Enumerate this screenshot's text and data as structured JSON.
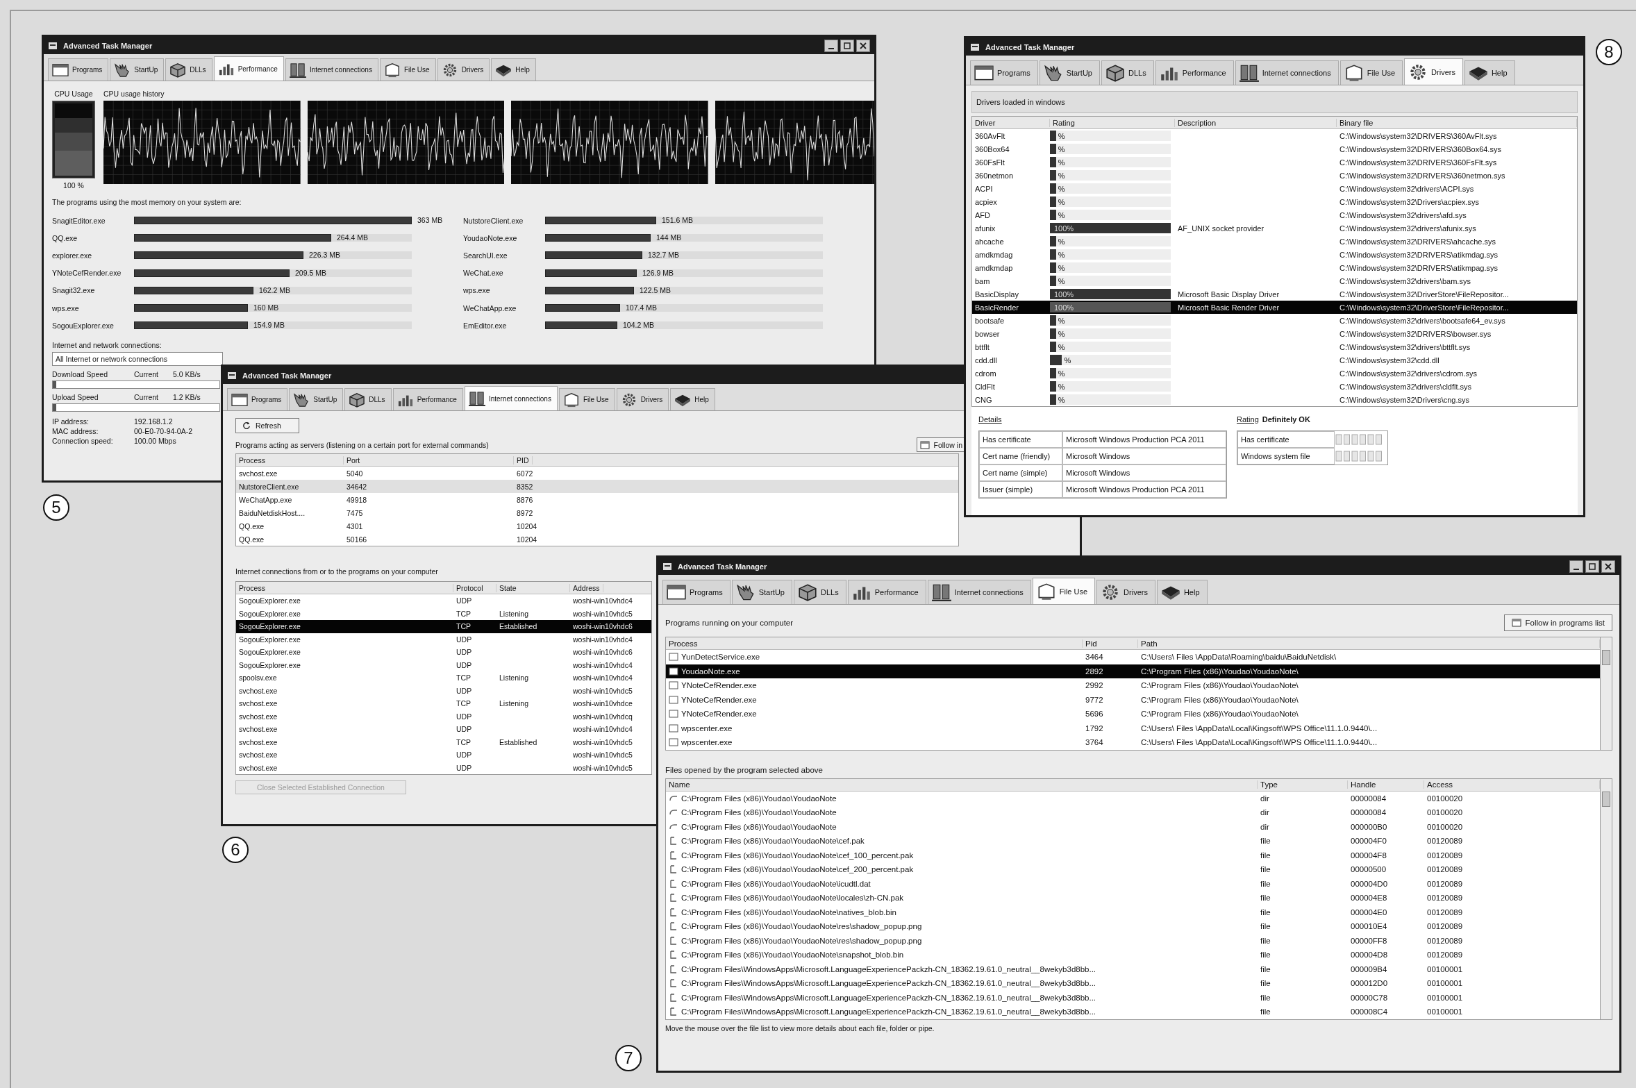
{
  "windows": [
    {
      "kind": "performance",
      "title": "Advanced Task Manager",
      "callout": "5",
      "window_buttons": true,
      "tabs": [
        {
          "label": "Programs",
          "selected": false
        },
        {
          "label": "StartUp",
          "selected": false
        },
        {
          "label": "DLLs",
          "selected": false
        },
        {
          "label": "Performance",
          "selected": true
        },
        {
          "label": "Internet connections",
          "selected": false
        },
        {
          "label": "File Use",
          "selected": false
        },
        {
          "label": "Drivers",
          "selected": false
        },
        {
          "label": "Help",
          "selected": false
        }
      ],
      "cpu": {
        "usage_label": "CPU Usage",
        "history_label": "CPU usage history",
        "reading": "100 %",
        "level": 1.0
      },
      "memory": {
        "caption": "The programs using the most memory on your system are:",
        "columns": [
          [
            {
              "name": "SnagitEditor.exe",
              "value": "363 MB",
              "level": 1.0
            },
            {
              "name": "QQ.exe",
              "value": "264.4 MB",
              "level": 0.71
            },
            {
              "name": "explorer.exe",
              "value": "226.3 MB",
              "level": 0.61
            },
            {
              "name": "YNoteCefRender.exe",
              "value": "209.5 MB",
              "level": 0.56
            },
            {
              "name": "Snagit32.exe",
              "value": "162.2 MB",
              "level": 0.43
            },
            {
              "name": "wps.exe",
              "value": "160 MB",
              "level": 0.41
            },
            {
              "name": "SogouExplorer.exe",
              "value": "154.9 MB",
              "level": 0.41
            }
          ],
          [
            {
              "name": "NutstoreClient.exe",
              "value": "151.6 MB",
              "level": 0.4
            },
            {
              "name": "YoudaoNote.exe",
              "value": "144 MB",
              "level": 0.38
            },
            {
              "name": "SearchUI.exe",
              "value": "132.7 MB",
              "level": 0.35
            },
            {
              "name": "WeChat.exe",
              "value": "126.9 MB",
              "level": 0.33
            },
            {
              "name": "wps.exe",
              "value": "122.5 MB",
              "level": 0.32
            },
            {
              "name": "WeChatApp.exe",
              "value": "107.4 MB",
              "level": 0.27
            },
            {
              "name": "EmEditor.exe",
              "value": "104.2 MB",
              "level": 0.26
            }
          ]
        ]
      },
      "network": {
        "caption": "Internet and network connections:",
        "dropdown": "All Internet or network connections",
        "speeds": [
          {
            "label": "Download Speed",
            "current_label": "Current",
            "reading": "5.0 KB/s",
            "level": 0.02
          },
          {
            "label": "Upload Speed",
            "current_label": "Current",
            "reading": "1.2 KB/s",
            "level": 0.02
          }
        ],
        "info": [
          {
            "label": "IP address:",
            "value": "192.168.1.2"
          },
          {
            "label": "MAC address:",
            "value": "00-E0-70-94-0A-2"
          },
          {
            "label": "Connection speed:",
            "value": "100.00 Mbps"
          }
        ]
      }
    },
    {
      "kind": "connections",
      "title": "Advanced Task Manager",
      "callout": "6",
      "window_buttons": false,
      "tabs": [
        {
          "label": "Programs",
          "selected": false
        },
        {
          "label": "StartUp",
          "selected": false
        },
        {
          "label": "DLLs",
          "selected": false
        },
        {
          "label": "Performance",
          "selected": false
        },
        {
          "label": "Internet connections",
          "selected": true
        },
        {
          "label": "File Use",
          "selected": false
        },
        {
          "label": "Drivers",
          "selected": false
        },
        {
          "label": "Help",
          "selected": false
        }
      ],
      "refresh_button": "Refresh",
      "follow_button": "Follow in",
      "servers": {
        "caption": "Programs acting as servers (listening on a certain port for external commands)",
        "columns": [
          "Process",
          "Port",
          "PID"
        ],
        "rows": [
          {
            "cells": [
              "svchost.exe",
              "5040",
              "6072"
            ],
            "selected": false
          },
          {
            "cells": [
              "NutstoreClient.exe",
              "34642",
              "8352"
            ],
            "selected": true
          },
          {
            "cells": [
              "WeChatApp.exe",
              "49918",
              "8876"
            ],
            "selected": false
          },
          {
            "cells": [
              "BaiduNetdiskHost....",
              "7475",
              "8972"
            ],
            "selected": false
          },
          {
            "cells": [
              "QQ.exe",
              "4301",
              "10204"
            ],
            "selected": false
          },
          {
            "cells": [
              "QQ.exe",
              "50166",
              "10204"
            ],
            "selected": false
          }
        ]
      },
      "connections": {
        "caption": "Internet connections from or to the programs on your computer",
        "columns": [
          "Process",
          "Protocol",
          "State",
          "Address"
        ],
        "rows": [
          {
            "process": "SogouExplorer.exe",
            "protocol": "UDP",
            "address": "woshi-win10vhdc4",
            "selected": false
          },
          {
            "process": "SogouExplorer.exe",
            "protocol": "TCP",
            "state": "Listening",
            "address": "woshi-win10vhdc5",
            "selected": false
          },
          {
            "process": "SogouExplorer.exe",
            "protocol": "TCP",
            "state": "Established",
            "address": "woshi-win10vhdc6",
            "selected": true
          },
          {
            "process": "SogouExplorer.exe",
            "protocol": "UDP",
            "address": "woshi-win10vhdc4",
            "selected": false
          },
          {
            "process": "SogouExplorer.exe",
            "protocol": "UDP",
            "address": "woshi-win10vhdc6",
            "selected": false
          },
          {
            "process": "SogouExplorer.exe",
            "protocol": "UDP",
            "address": "woshi-win10vhdc4",
            "selected": false
          },
          {
            "process": "spoolsv.exe",
            "protocol": "TCP",
            "state": "Listening",
            "address": "woshi-win10vhdc4",
            "selected": false
          },
          {
            "process": "svchost.exe",
            "protocol": "UDP",
            "address": "woshi-win10vhdc5",
            "selected": false
          },
          {
            "process": "svchost.exe",
            "protocol": "TCP",
            "state": "Listening",
            "address": "woshi-win10vhdce",
            "selected": false
          },
          {
            "process": "svchost.exe",
            "protocol": "UDP",
            "address": "woshi-win10vhdcq",
            "selected": false
          },
          {
            "process": "svchost.exe",
            "protocol": "UDP",
            "address": "woshi-win10vhdc4",
            "selected": false
          },
          {
            "process": "svchost.exe",
            "protocol": "TCP",
            "state": "Established",
            "address": "woshi-win10vhdc5",
            "selected": false
          },
          {
            "process": "svchost.exe",
            "protocol": "UDP",
            "address": "woshi-win10vhdc5",
            "selected": false
          },
          {
            "process": "svchost.exe",
            "protocol": "UDP",
            "address": "woshi-win10vhdc5",
            "selected": false
          }
        ]
      },
      "close_button": {
        "label": "Close Selected Established Connection",
        "disabled": true
      }
    },
    {
      "kind": "drivers",
      "title": "Advanced Task Manager",
      "callout": "8",
      "window_buttons": false,
      "tabs": [
        {
          "label": "Programs",
          "selected": false
        },
        {
          "label": "StartUp",
          "selected": false
        },
        {
          "label": "DLLs",
          "selected": false
        },
        {
          "label": "Performance",
          "selected": false
        },
        {
          "label": "Internet connections",
          "selected": false
        },
        {
          "label": "File Use",
          "selected": false
        },
        {
          "label": "Drivers",
          "selected": true
        },
        {
          "label": "Help",
          "selected": false
        }
      ],
      "caption": "Drivers loaded in windows",
      "columns": [
        "Driver",
        "Rating",
        "Description",
        "Binary file"
      ],
      "rows": [
        {
          "driver": "360AvFlt",
          "rating": {
            "reading": "%",
            "level": 0.05
          },
          "binary": "C:\\Windows\\system32\\DRIVERS\\360AvFlt.sys",
          "selected": false
        },
        {
          "driver": "360Box64",
          "rating": {
            "reading": "%",
            "level": 0.05
          },
          "binary": "C:\\Windows\\system32\\DRIVERS\\360Box64.sys",
          "selected": false
        },
        {
          "driver": "360FsFlt",
          "rating": {
            "reading": "%",
            "level": 0.05
          },
          "binary": "C:\\Windows\\system32\\DRIVERS\\360FsFlt.sys",
          "selected": false
        },
        {
          "driver": "360netmon",
          "rating": {
            "reading": "%",
            "level": 0.05
          },
          "binary": "C:\\Windows\\system32\\DRIVERS\\360netmon.sys",
          "selected": false
        },
        {
          "driver": "ACPI",
          "rating": {
            "reading": "%",
            "level": 0.05
          },
          "binary": "C:\\Windows\\system32\\drivers\\ACPI.sys",
          "selected": false
        },
        {
          "driver": "acpiex",
          "rating": {
            "reading": "%",
            "level": 0.05
          },
          "binary": "C:\\Windows\\system32\\Drivers\\acpiex.sys",
          "selected": false
        },
        {
          "driver": "AFD",
          "rating": {
            "reading": "%",
            "level": 0.05
          },
          "binary": "C:\\Windows\\system32\\drivers\\afd.sys",
          "selected": false
        },
        {
          "driver": "afunix",
          "rating": {
            "reading": "100%",
            "level": 1.0
          },
          "description": "AF_UNIX socket provider",
          "binary": "C:\\Windows\\system32\\drivers\\afunix.sys",
          "selected": false
        },
        {
          "driver": "ahcache",
          "rating": {
            "reading": "%",
            "level": 0.05
          },
          "binary": "C:\\Windows\\system32\\DRIVERS\\ahcache.sys",
          "selected": false
        },
        {
          "driver": "amdkmdag",
          "rating": {
            "reading": "%",
            "level": 0.05
          },
          "binary": "C:\\Windows\\system32\\DRIVERS\\atikmdag.sys",
          "selected": false
        },
        {
          "driver": "amdkmdap",
          "rating": {
            "reading": "%",
            "level": 0.05
          },
          "binary": "C:\\Windows\\system32\\DRIVERS\\atikmpag.sys",
          "selected": false
        },
        {
          "driver": "bam",
          "rating": {
            "reading": "%",
            "level": 0.05
          },
          "binary": "C:\\Windows\\system32\\drivers\\bam.sys",
          "selected": false
        },
        {
          "driver": "BasicDisplay",
          "rating": {
            "reading": "100%",
            "level": 1.0
          },
          "description": "Microsoft Basic Display Driver",
          "binary": "C:\\Windows\\system32\\DriverStore\\FileRepositor...",
          "selected": false
        },
        {
          "driver": "BasicRender",
          "rating": {
            "reading": "100%",
            "level": 1.0
          },
          "description": "Microsoft Basic Render Driver",
          "binary": "C:\\Windows\\system32\\DriverStore\\FileRepositor...",
          "selected": true
        },
        {
          "driver": "bootsafe",
          "rating": {
            "reading": "%",
            "level": 0.05
          },
          "binary": "C:\\Windows\\system32\\drivers\\bootsafe64_ev.sys",
          "selected": false
        },
        {
          "driver": "bowser",
          "rating": {
            "reading": "%",
            "level": 0.05
          },
          "binary": "C:\\Windows\\system32\\DRIVERS\\bowser.sys",
          "selected": false
        },
        {
          "driver": "bttflt",
          "rating": {
            "reading": "%",
            "level": 0.05
          },
          "binary": "C:\\Windows\\system32\\drivers\\bttflt.sys",
          "selected": false
        },
        {
          "driver": "cdd.dll",
          "rating": {
            "reading": "%",
            "level": 0.1
          },
          "binary": "C:\\Windows\\system32\\cdd.dll",
          "selected": false
        },
        {
          "driver": "cdrom",
          "rating": {
            "reading": "%",
            "level": 0.05
          },
          "binary": "C:\\Windows\\system32\\drivers\\cdrom.sys",
          "selected": false
        },
        {
          "driver": "CldFlt",
          "rating": {
            "reading": "%",
            "level": 0.05
          },
          "binary": "C:\\Windows\\system32\\drivers\\cldflt.sys",
          "selected": false
        },
        {
          "driver": "CNG",
          "rating": {
            "reading": "%",
            "level": 0.05
          },
          "binary": "C:\\Windows\\system32\\Drivers\\cng.sys",
          "selected": false
        }
      ],
      "details": {
        "title": "Details",
        "rows": [
          [
            "Has certificate",
            "Microsoft Windows Production PCA 2011"
          ],
          [
            "Cert name (friendly)",
            "Microsoft Windows"
          ],
          [
            "Cert name (simple)",
            "Microsoft Windows"
          ],
          [
            "Issuer (simple)",
            "Microsoft Windows Production PCA 2011"
          ]
        ],
        "rating_label": "Rating",
        "rating_value": "Definitely OK",
        "checks": [
          "Has certificate",
          "Windows system file"
        ]
      }
    },
    {
      "kind": "file_use",
      "title": "Advanced Task Manager",
      "callout": "7",
      "window_buttons": true,
      "tabs": [
        {
          "label": "Programs",
          "selected": false
        },
        {
          "label": "StartUp",
          "selected": false
        },
        {
          "label": "DLLs",
          "selected": false
        },
        {
          "label": "Performance",
          "selected": false
        },
        {
          "label": "Internet connections",
          "selected": false
        },
        {
          "label": "File Use",
          "selected": true
        },
        {
          "label": "Drivers",
          "selected": false
        },
        {
          "label": "Help",
          "selected": false
        }
      ],
      "caption": "Programs running on your computer",
      "follow_button": "Follow in programs list",
      "process_columns": [
        "Process",
        "Pid",
        "Path"
      ],
      "processes": [
        {
          "name": "YunDetectService.exe",
          "pid": "3464",
          "path": "C:\\Users\\ Files \\AppData\\Roaming\\baidu\\BaiduNetdisk\\",
          "selected": false
        },
        {
          "name": "YoudaoNote.exe",
          "pid": "2892",
          "path": "C:\\Program Files (x86)\\Youdao\\YoudaoNote\\",
          "selected": true
        },
        {
          "name": "YNoteCefRender.exe",
          "pid": "2992",
          "path": "C:\\Program Files (x86)\\Youdao\\YoudaoNote\\",
          "selected": false
        },
        {
          "name": "YNoteCefRender.exe",
          "pid": "9772",
          "path": "C:\\Program Files (x86)\\Youdao\\YoudaoNote\\",
          "selected": false
        },
        {
          "name": "YNoteCefRender.exe",
          "pid": "5696",
          "path": "C:\\Program Files (x86)\\Youdao\\YoudaoNote\\",
          "selected": false
        },
        {
          "name": "wpscenter.exe",
          "pid": "1792",
          "path": "C:\\Users\\ Files \\AppData\\Local\\Kingsoft\\WPS Office\\11.1.0.9440\\...",
          "selected": false
        },
        {
          "name": "wpscenter.exe",
          "pid": "3764",
          "path": "C:\\Users\\ Files \\AppData\\Local\\Kingsoft\\WPS Office\\11.1.0.9440\\...",
          "selected": false
        }
      ],
      "files_caption": "Files opened by the program selected above",
      "file_columns": [
        "Name",
        "Type",
        "Handle",
        "Access"
      ],
      "files": [
        {
          "kind": "dir",
          "name": "C:\\Program Files (x86)\\Youdao\\YoudaoNote",
          "type": "dir",
          "handle": "00000084",
          "access": "00100020"
        },
        {
          "kind": "dir",
          "name": "C:\\Program Files (x86)\\Youdao\\YoudaoNote",
          "type": "dir",
          "handle": "00000084",
          "access": "00100020"
        },
        {
          "kind": "dir",
          "name": "C:\\Program Files (x86)\\Youdao\\YoudaoNote",
          "type": "dir",
          "handle": "000000B0",
          "access": "00100020"
        },
        {
          "kind": "file",
          "name": "C:\\Program Files (x86)\\Youdao\\YoudaoNote\\cef.pak",
          "type": "file",
          "handle": "000004F0",
          "access": "00120089"
        },
        {
          "kind": "file",
          "name": "C:\\Program Files (x86)\\Youdao\\YoudaoNote\\cef_100_percent.pak",
          "type": "file",
          "handle": "000004F8",
          "access": "00120089"
        },
        {
          "kind": "file",
          "name": "C:\\Program Files (x86)\\Youdao\\YoudaoNote\\cef_200_percent.pak",
          "type": "file",
          "handle": "00000500",
          "access": "00120089"
        },
        {
          "kind": "file",
          "name": "C:\\Program Files (x86)\\Youdao\\YoudaoNote\\icudtl.dat",
          "type": "file",
          "handle": "000004D0",
          "access": "00120089"
        },
        {
          "kind": "file",
          "name": "C:\\Program Files (x86)\\Youdao\\YoudaoNote\\locales\\zh-CN.pak",
          "type": "file",
          "handle": "000004E8",
          "access": "00120089"
        },
        {
          "kind": "file",
          "name": "C:\\Program Files (x86)\\Youdao\\YoudaoNote\\natives_blob.bin",
          "type": "file",
          "handle": "000004E0",
          "access": "00120089"
        },
        {
          "kind": "file",
          "name": "C:\\Program Files (x86)\\Youdao\\YoudaoNote\\res\\shadow_popup.png",
          "type": "file",
          "handle": "000010E4",
          "access": "00120089"
        },
        {
          "kind": "file",
          "name": "C:\\Program Files (x86)\\Youdao\\YoudaoNote\\res\\shadow_popup.png",
          "type": "file",
          "handle": "00000FF8",
          "access": "00120089"
        },
        {
          "kind": "file",
          "name": "C:\\Program Files (x86)\\Youdao\\YoudaoNote\\snapshot_blob.bin",
          "type": "file",
          "handle": "000004D8",
          "access": "00120089"
        },
        {
          "kind": "file",
          "name": "C:\\Program Files\\WindowsApps\\Microsoft.LanguageExperiencePackzh-CN_18362.19.61.0_neutral__8wekyb3d8bb...",
          "type": "file",
          "handle": "000009B4",
          "access": "00100001"
        },
        {
          "kind": "file",
          "name": "C:\\Program Files\\WindowsApps\\Microsoft.LanguageExperiencePackzh-CN_18362.19.61.0_neutral__8wekyb3d8bb...",
          "type": "file",
          "handle": "000012D0",
          "access": "00100001"
        },
        {
          "kind": "file",
          "name": "C:\\Program Files\\WindowsApps\\Microsoft.LanguageExperiencePackzh-CN_18362.19.61.0_neutral__8wekyb3d8bb...",
          "type": "file",
          "handle": "00000C78",
          "access": "00100001"
        },
        {
          "kind": "file",
          "name": "C:\\Program Files\\WindowsApps\\Microsoft.LanguageExperiencePackzh-CN_18362.19.61.0_neutral__8wekyb3d8bb...",
          "type": "file",
          "handle": "000008C4",
          "access": "00100001"
        }
      ],
      "status": "Move the mouse over the file list to view more details about each file, folder or pipe."
    }
  ]
}
